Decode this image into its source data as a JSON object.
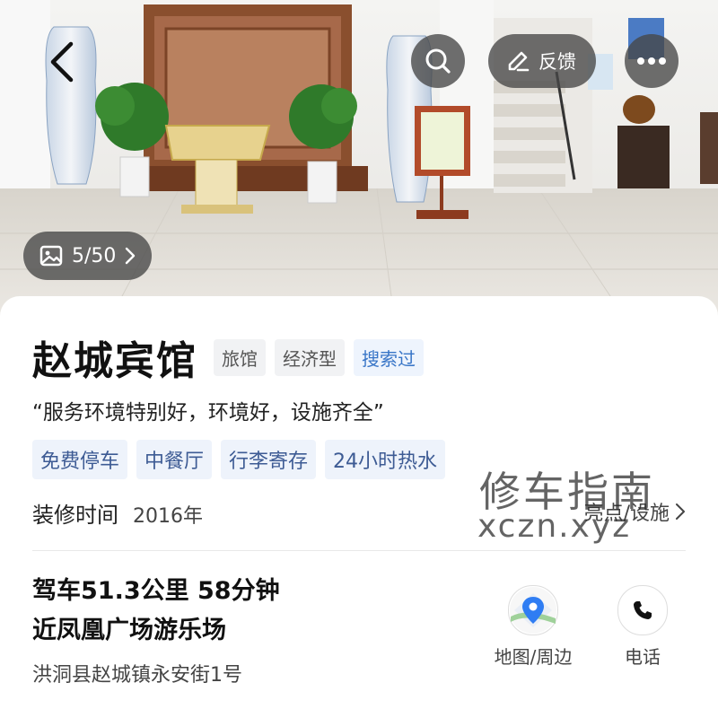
{
  "header": {
    "back_icon": "chevron-left-icon",
    "search_icon": "search-icon",
    "feedback_label": "反馈",
    "feedback_icon": "edit-icon",
    "more_icon": "more-dots-icon",
    "photo_counter": "5/50",
    "photo_icon": "image-icon"
  },
  "hotel": {
    "name": "赵城宾馆",
    "tags": [
      "旅馆",
      "经济型"
    ],
    "searched_tag": "搜索过",
    "quote": "“服务环境特别好，环境好，设施齐全”",
    "amenities": [
      "免费停车",
      "中餐厅",
      "行李寄存",
      "24小时热水"
    ],
    "renovation_label": "装修时间",
    "renovation_year": "2016年",
    "highlights_label": "亮点/设施"
  },
  "route": {
    "drive": "驾车51.3公里  58分钟",
    "nearby_poi": "近凤凰广场游乐场",
    "address": "洪洞县赵城镇永安街1号"
  },
  "actions": {
    "map_label": "地图/周边",
    "phone_label": "电话"
  },
  "watermark": {
    "line1": "修车指南",
    "line2": "xczn.xyz"
  },
  "colors": {
    "accent_blue": "#3875c7",
    "amenity_text": "#3d5b94",
    "overlay": "#464646"
  }
}
